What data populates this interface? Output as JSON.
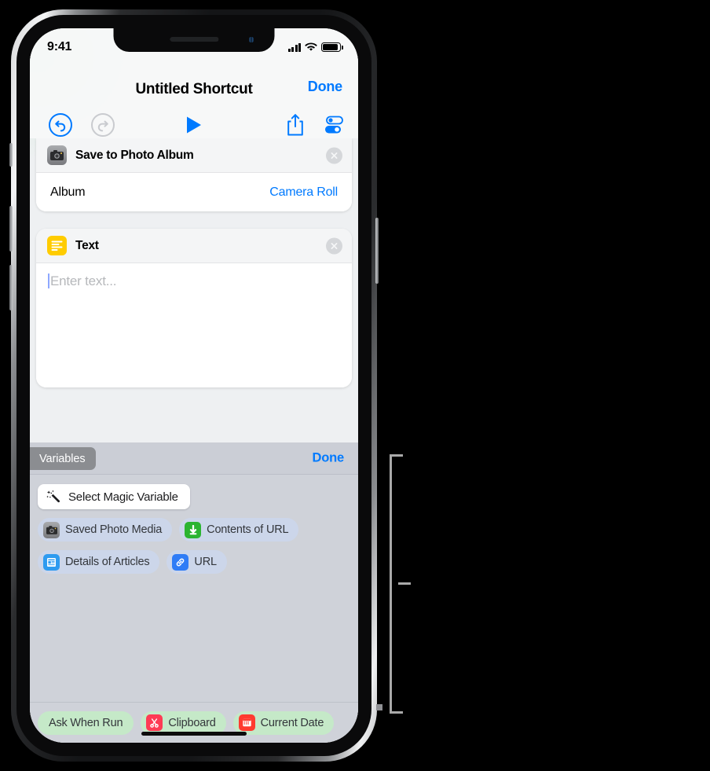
{
  "status_bar": {
    "time": "9:41",
    "icons": [
      "cellular-bars-icon",
      "wifi-icon",
      "battery-icon"
    ]
  },
  "nav": {
    "title": "Untitled Shortcut",
    "done_label": "Done"
  },
  "toolbar": {
    "undo": {
      "name": "undo-button",
      "enabled": true
    },
    "redo": {
      "name": "redo-button",
      "enabled": false
    },
    "play": {
      "name": "play-button"
    },
    "share": {
      "name": "share-button"
    },
    "settings": {
      "name": "settings-button"
    }
  },
  "actions": [
    {
      "title": "Save to Photo Album",
      "icon": "camera-icon",
      "icon_color": "#8e8e93",
      "param_label": "Album",
      "param_value": "Camera Roll",
      "delete_label": "×"
    },
    {
      "title": "Text",
      "icon": "text-lines-icon",
      "icon_color": "#ffcc00",
      "placeholder": "Enter text...",
      "value": "",
      "delete_label": "×"
    }
  ],
  "accessory": {
    "tab_label": "Variables",
    "done_label": "Done",
    "magic_button": {
      "label": "Select Magic Variable",
      "icon": "magic-wand-icon"
    },
    "magic_variables": [
      {
        "label": "Saved Photo Media",
        "icon": "camera-icon",
        "icon_color": "#8e8e93"
      },
      {
        "label": "Contents of URL",
        "icon": "download-arrow-icon",
        "icon_color": "#2bb431"
      },
      {
        "label": "Details of Articles",
        "icon": "article-icon",
        "icon_color": "#2e9bf0"
      },
      {
        "label": "URL",
        "icon": "link-icon",
        "icon_color": "#2f7cf6"
      }
    ],
    "builtin_variables": [
      {
        "label": "Ask When Run",
        "icon": null,
        "icon_color": null
      },
      {
        "label": "Clipboard",
        "icon": "scissors-icon",
        "icon_color": "#ff3b54"
      },
      {
        "label": "Current Date",
        "icon": "calendar-icon",
        "icon_color": "#ff3b30"
      }
    ]
  },
  "colors": {
    "accent_blue": "#007aff",
    "panel_bg": "#cfd2d9",
    "magic_chip_bg": "#ccd6ea",
    "builtin_chip_bg": "#c5e9c8",
    "tab_gray": "#8b8d91"
  }
}
